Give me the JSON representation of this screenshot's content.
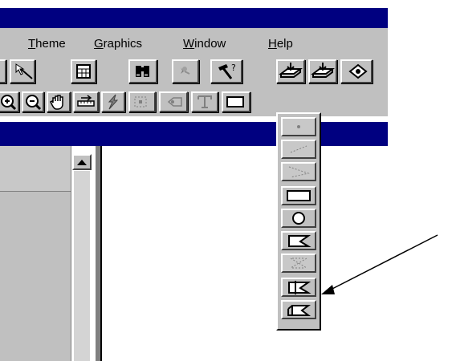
{
  "menu": {
    "items": [
      {
        "label": "Theme"
      },
      {
        "label": "Graphics"
      },
      {
        "label": "Window"
      },
      {
        "label": "Help"
      }
    ]
  },
  "colors": {
    "title_bar": "#000080",
    "chrome": "#c0c0c0",
    "canvas": "#ffffff"
  },
  "toolbar_icons": {
    "row1": [
      "button-edge-icon",
      "pointer-line-icon",
      "table-icon",
      "binoculars-icon",
      "hotlink-icon",
      "hammer-query-icon",
      "export-icon",
      "import-icon",
      "layer-icon"
    ],
    "row2": [
      "zoom-in-icon",
      "zoom-out-icon",
      "pan-hand-icon",
      "measure-icon",
      "lightning-icon",
      "area-select-icon",
      "label-icon",
      "text-tool-icon",
      "draw-rectangle-icon"
    ]
  },
  "palette_tools": [
    "point-icon",
    "line-icon",
    "polyline-icon",
    "rectangle-icon",
    "circle-icon",
    "polygon-icon",
    "polygon-dashed-icon",
    "split-polygon-icon",
    "append-polygon-icon"
  ]
}
